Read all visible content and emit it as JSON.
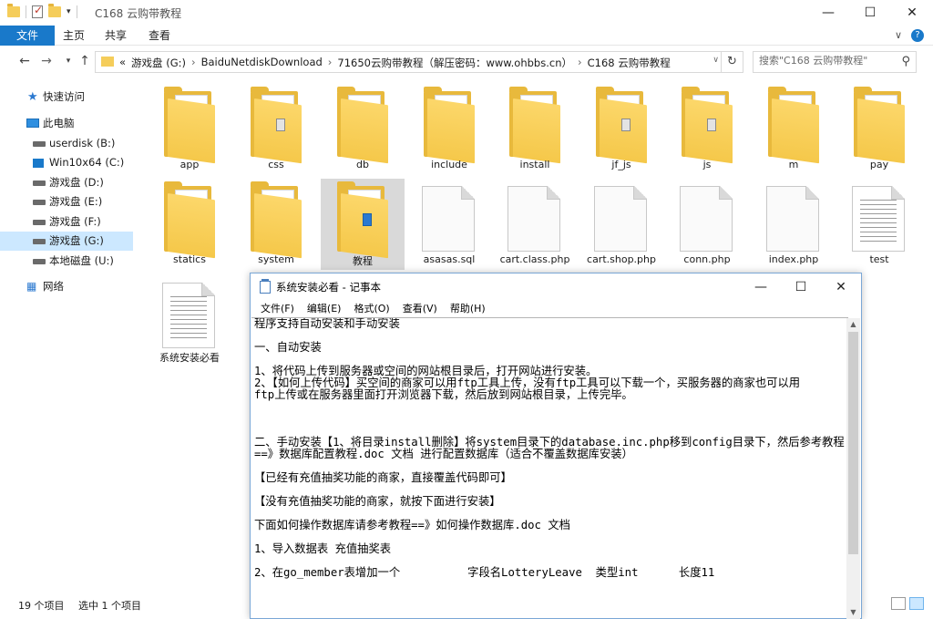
{
  "explorer": {
    "window_title": "C168 云购带教程",
    "ribbon": {
      "file": "文件",
      "home": "主页",
      "share": "共享",
      "view": "查看"
    },
    "address": {
      "crumbs": [
        "«",
        "游戏盘 (G:)",
        "›",
        "BaiduNetdiskDownload",
        "›",
        "71650云购带教程（解压密码：www.ohbbs.cn）",
        "›",
        "C168 云购带教程"
      ]
    },
    "search": {
      "placeholder": "搜索\"C168 云购带教程\""
    },
    "nav": {
      "quick_access": "快速访问",
      "this_pc": "此电脑",
      "drives": [
        "userdisk (B:)",
        "Win10x64 (C:)",
        "游戏盘 (D:)",
        "游戏盘 (E:)",
        "游戏盘 (F:)",
        "游戏盘 (G:)",
        "本地磁盘 (U:)"
      ],
      "network": "网络"
    },
    "items": [
      {
        "name": "app",
        "type": "folder"
      },
      {
        "name": "css",
        "type": "folder"
      },
      {
        "name": "db",
        "type": "folder"
      },
      {
        "name": "include",
        "type": "folder"
      },
      {
        "name": "install",
        "type": "folder"
      },
      {
        "name": "jf_js",
        "type": "folder"
      },
      {
        "name": "js",
        "type": "folder"
      },
      {
        "name": "m",
        "type": "folder"
      },
      {
        "name": "pay",
        "type": "folder"
      },
      {
        "name": "statics",
        "type": "folder"
      },
      {
        "name": "system",
        "type": "folder"
      },
      {
        "name": "教程",
        "type": "folder",
        "selected": true
      },
      {
        "name": "asasas.sql",
        "type": "file"
      },
      {
        "name": "cart.class.php",
        "type": "file"
      },
      {
        "name": "cart.shop.php",
        "type": "file"
      },
      {
        "name": "conn.php",
        "type": "file"
      },
      {
        "name": "index.php",
        "type": "file"
      },
      {
        "name": "test",
        "type": "text"
      },
      {
        "name": "系统安装必看",
        "type": "text"
      }
    ],
    "status": {
      "count": "19 个项目",
      "selected": "选中 1 个项目"
    }
  },
  "notepad": {
    "title": "系统安装必看 - 记事本",
    "menu": [
      "文件(F)",
      "编辑(E)",
      "格式(O)",
      "查看(V)",
      "帮助(H)"
    ],
    "content": "程序支持自动安装和手动安装\n\n一、自动安装\n\n1、将代码上传到服务器或空间的网站根目录后，打开网站进行安装。\n2、【如何上传代码】买空间的商家可以用ftp工具上传，没有ftp工具可以下载一个，买服务器的商家也可以用\nftp上传或在服务器里面打开浏览器下载，然后放到网站根目录，上传完毕。\n\n\n\n二、手动安装【1、将目录install删除】将system目录下的database.inc.php移到config目录下，然后参考教程==》数据库配置教程.doc 文档 进行配置数据库（适合不覆盖数据库安装）\n\n【已经有充值抽奖功能的商家，直接覆盖代码即可】\n\n【没有充值抽奖功能的商家，就按下面进行安装】\n\n下面如何操作数据库请参考教程==》如何操作数据库.doc 文档\n\n1、导入数据表 充值抽奖表\n\n2、在go_member表增加一个          字段名LotteryLeave  类型int      长度11"
  }
}
